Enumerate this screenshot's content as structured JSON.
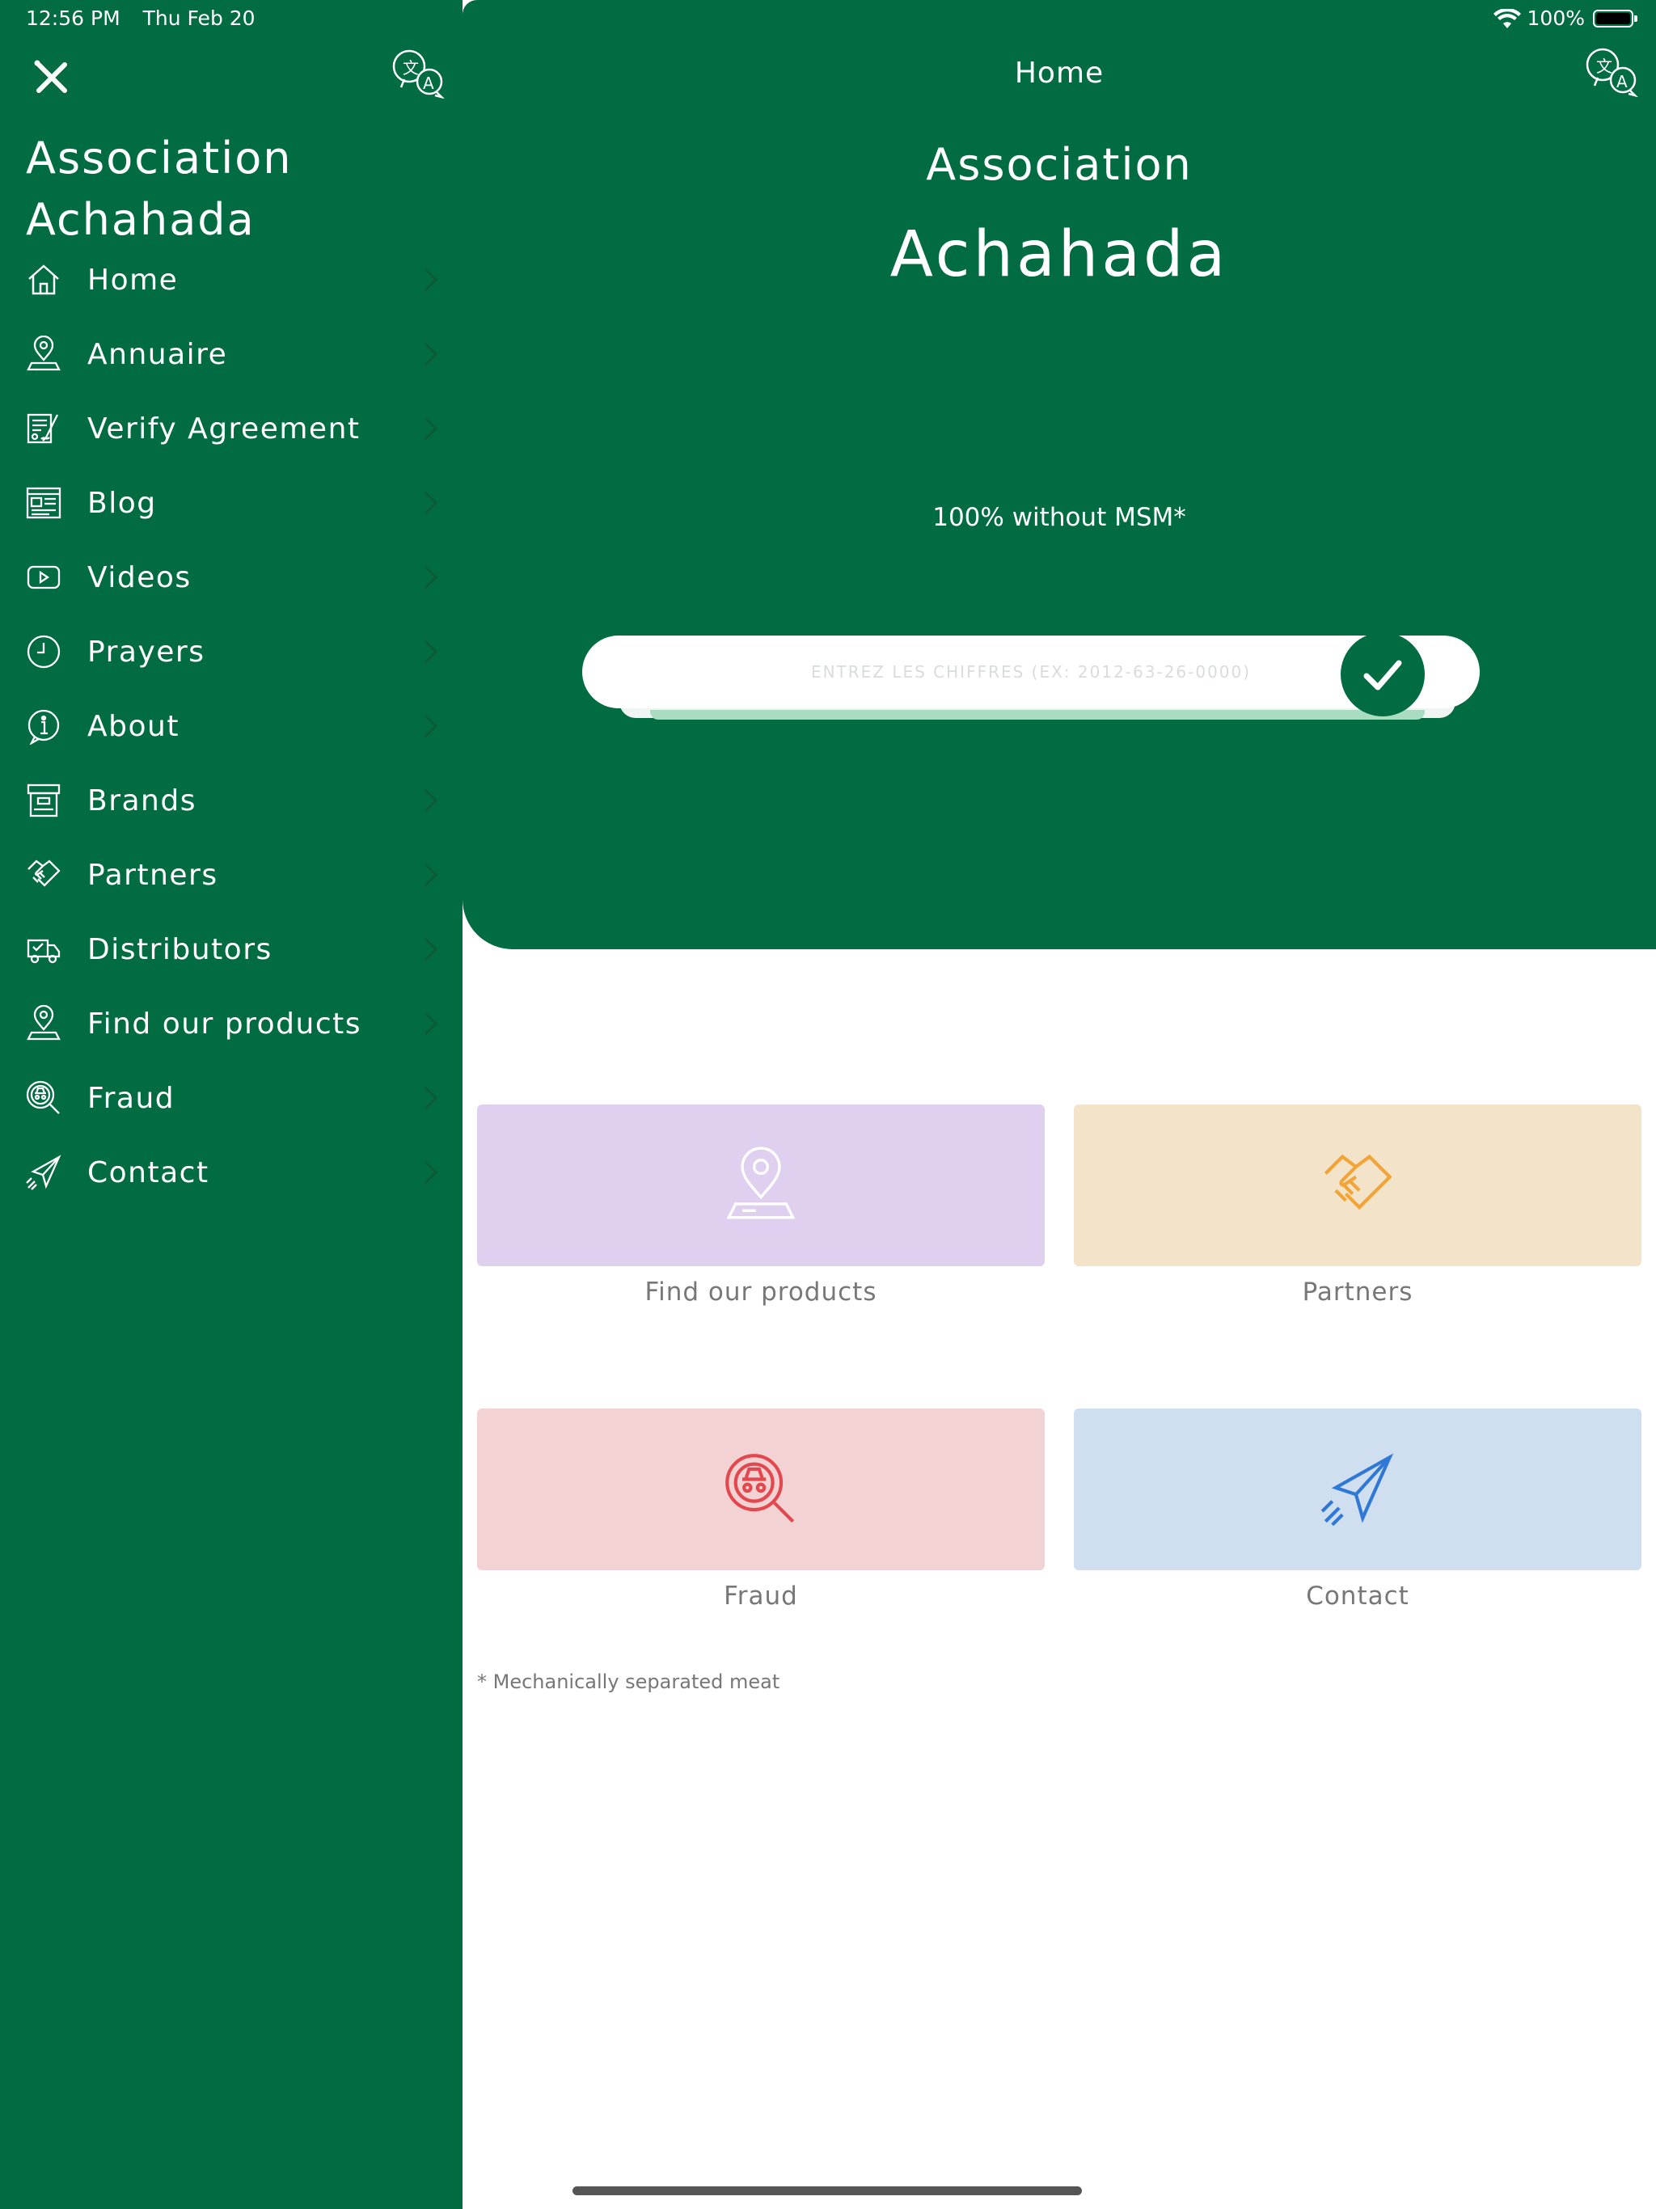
{
  "status_bar": {
    "time": "12:56 PM",
    "date": "Thu Feb 20",
    "battery": "100%"
  },
  "sidebar": {
    "title": "Association Achahada",
    "icons": {
      "close": "close-x-icon",
      "translate": "translate-icon"
    },
    "items": [
      {
        "label": "Home",
        "icon": "home-icon"
      },
      {
        "label": "Annuaire",
        "icon": "location-pin-icon"
      },
      {
        "label": "Verify Agreement",
        "icon": "certificate-icon"
      },
      {
        "label": "Blog",
        "icon": "newspaper-icon"
      },
      {
        "label": "Videos",
        "icon": "play-icon"
      },
      {
        "label": "Prayers",
        "icon": "clock-icon"
      },
      {
        "label": "About",
        "icon": "info-icon"
      },
      {
        "label": "Brands",
        "icon": "archive-box-icon"
      },
      {
        "label": "Partners",
        "icon": "handshake-icon"
      },
      {
        "label": "Distributors",
        "icon": "truck-icon"
      },
      {
        "label": "Find our products",
        "icon": "location-pin-icon"
      },
      {
        "label": "Fraud",
        "icon": "spy-magnifier-icon"
      },
      {
        "label": "Contact",
        "icon": "paper-plane-icon"
      }
    ]
  },
  "main": {
    "nav_title": "Home",
    "hero_subtitle": "Association",
    "hero_title": "Achahada",
    "tagline": "100% without MSM*",
    "code_input": {
      "placeholder": "ENTREZ LES CHIFFRES (EX: 2012-63-26-0000)",
      "value": ""
    },
    "tiles": [
      {
        "label": "Find our products",
        "icon": "location-pin-icon",
        "bg": "#dfd0f0",
        "icon_color": "#ffffff"
      },
      {
        "label": "Partners",
        "icon": "handshake-icon",
        "bg": "#f3e3c9",
        "icon_color": "#f2a436"
      },
      {
        "label": "Fraud",
        "icon": "spy-magnifier-icon",
        "bg": "#f3d2d4",
        "icon_color": "#e2494e"
      },
      {
        "label": "Contact",
        "icon": "paper-plane-icon",
        "bg": "#cfdff0",
        "icon_color": "#2f78d6"
      }
    ],
    "footnote": "* Mechanically separated meat"
  },
  "colors": {
    "brand_green": "#016b41",
    "background": "#ffffff",
    "muted_text": "#777777"
  }
}
